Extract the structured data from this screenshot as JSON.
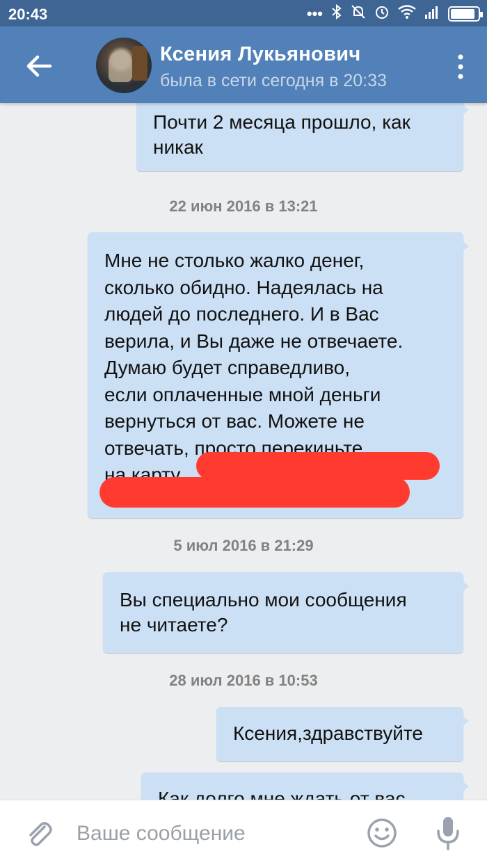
{
  "status_bar": {
    "time": "20:43",
    "icons": [
      "dots-icon",
      "bluetooth-icon",
      "mute-icon",
      "alarm-icon",
      "wifi-icon",
      "signal-icon",
      "battery-icon"
    ],
    "battery_level": 0.9
  },
  "header": {
    "contact_name": "Ксения Лукьянович",
    "contact_status": "была в сети сегодня в 20:33",
    "back_icon": "arrow-left-icon",
    "menu_icon": "more-vertical-icon"
  },
  "messages": [
    {
      "type": "msg",
      "text": "Почти 2 месяца прошло, как\nникак"
    },
    {
      "type": "date",
      "text": "22 июн 2016 в 13:21"
    },
    {
      "type": "msg",
      "text": "Мне не столько жалко денег,\nсколько обидно. Надеялась на\nлюдей до последнего.  И в Вас\nверила,  и Вы даже не отвечаете.\nДумаю будет справедливо,\nесли оплаченные мной деньги\nвернуться от вас.  Можете не\nотвечать, просто перекиньте\nна карту."
    },
    {
      "type": "date",
      "text": "5 июл 2016 в 21:29"
    },
    {
      "type": "msg",
      "text": "Вы специально мои сообщения\nне читаете?"
    },
    {
      "type": "date",
      "text": "28 июл 2016 в 10:53"
    },
    {
      "type": "msg",
      "text": "Ксения,здравствуйте"
    },
    {
      "type": "msg",
      "text": "Как долго мне ждать от вас"
    }
  ],
  "composer": {
    "placeholder": "Ваше сообщение",
    "attach_icon": "paperclip-icon",
    "emoji_icon": "smiley-icon",
    "mic_icon": "microphone-icon"
  },
  "colors": {
    "status_bar": "#3e6593",
    "app_bar": "#5181b8",
    "bubble": "#cce0f5",
    "background": "#edeef0",
    "redaction": "#ff3b30"
  }
}
